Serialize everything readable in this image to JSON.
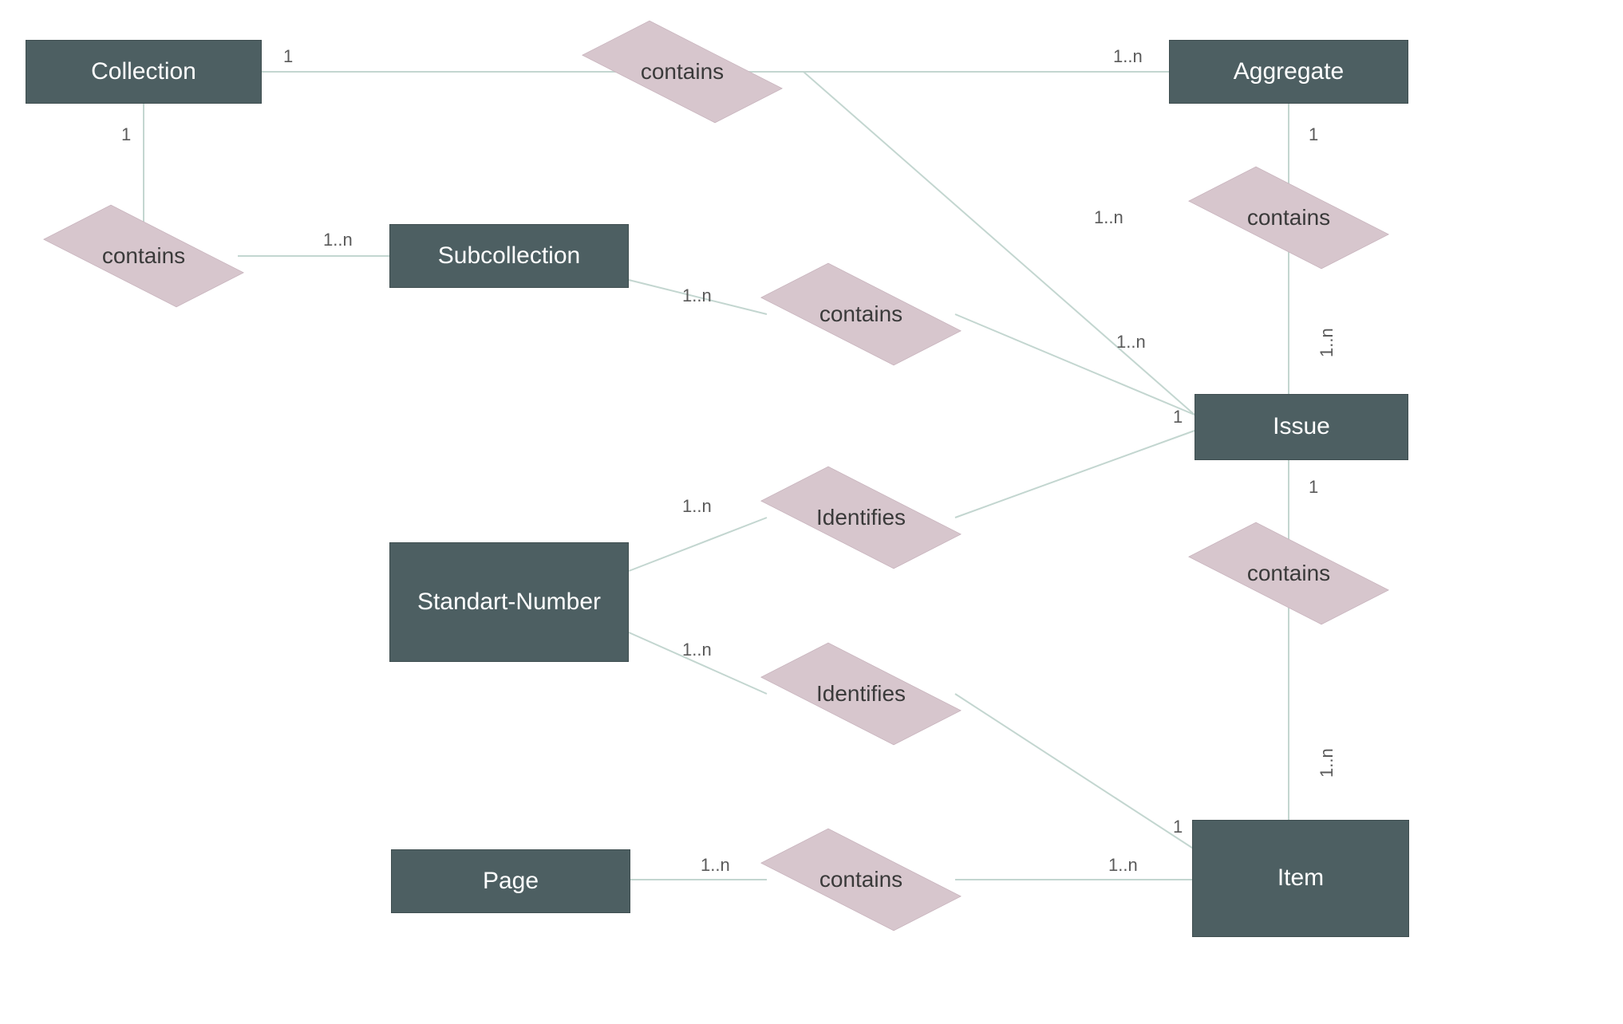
{
  "entities": {
    "collection": "Collection",
    "subcollection": "Subcollection",
    "aggregate": "Aggregate",
    "issue": "Issue",
    "standart_number": "Standart-Number",
    "page": "Page",
    "item": "Item"
  },
  "relationships": {
    "contains_collection_aggregate": "contains",
    "contains_collection_subcollection": "contains",
    "contains_aggregate_issue": "contains",
    "contains_subcollection_issue": "contains",
    "identifies_standart_issue": "Identifies",
    "identifies_standart_item": "Identifies",
    "contains_issue_item": "contains",
    "contains_item_page": "contains"
  },
  "cardinalities": {
    "c_collection_top_right": "1",
    "c_collection_bottom": "1",
    "c_subcollection_left": "1..n",
    "c_aggregate_left": "1..n",
    "c_aggregate_bottom": "1",
    "c_issue_top_vert": "1..n",
    "c_issue_top_left_diag": "1..n",
    "c_subcollection_right": "1..n",
    "c_issue_left_from_sub": "1..n",
    "c_issue_left_from_ident": "1",
    "c_standart_top_right": "1..n",
    "c_standart_bottom_right": "1..n",
    "c_item_left_from_ident": "1",
    "c_issue_bottom": "1",
    "c_item_top_vert": "1..n",
    "c_item_left_from_page": "1..n",
    "c_page_right": "1..n"
  },
  "colors": {
    "entity_bg": "#4d5f62",
    "entity_text": "#ffffff",
    "diamond_bg": "#d7c6cd",
    "line": "#c3d6d0",
    "card_text": "#5a5a5a"
  },
  "font_sizes": {
    "entity": 30,
    "diamond": 28,
    "card": 22
  }
}
